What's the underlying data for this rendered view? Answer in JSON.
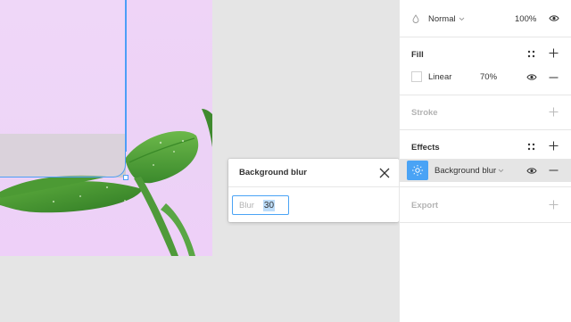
{
  "layer": {
    "blend_mode": "Normal",
    "opacity": "100%"
  },
  "fill": {
    "title": "Fill",
    "type": "Linear",
    "opacity": "70%"
  },
  "stroke": {
    "title": "Stroke"
  },
  "effects": {
    "title": "Effects",
    "effect_name": "Background blur"
  },
  "export": {
    "title": "Export"
  },
  "popover": {
    "title": "Background blur",
    "blur_label": "Blur",
    "blur_value": "30"
  },
  "colors": {
    "accent": "#4aa3f5",
    "selection": "#4d9ef7"
  }
}
